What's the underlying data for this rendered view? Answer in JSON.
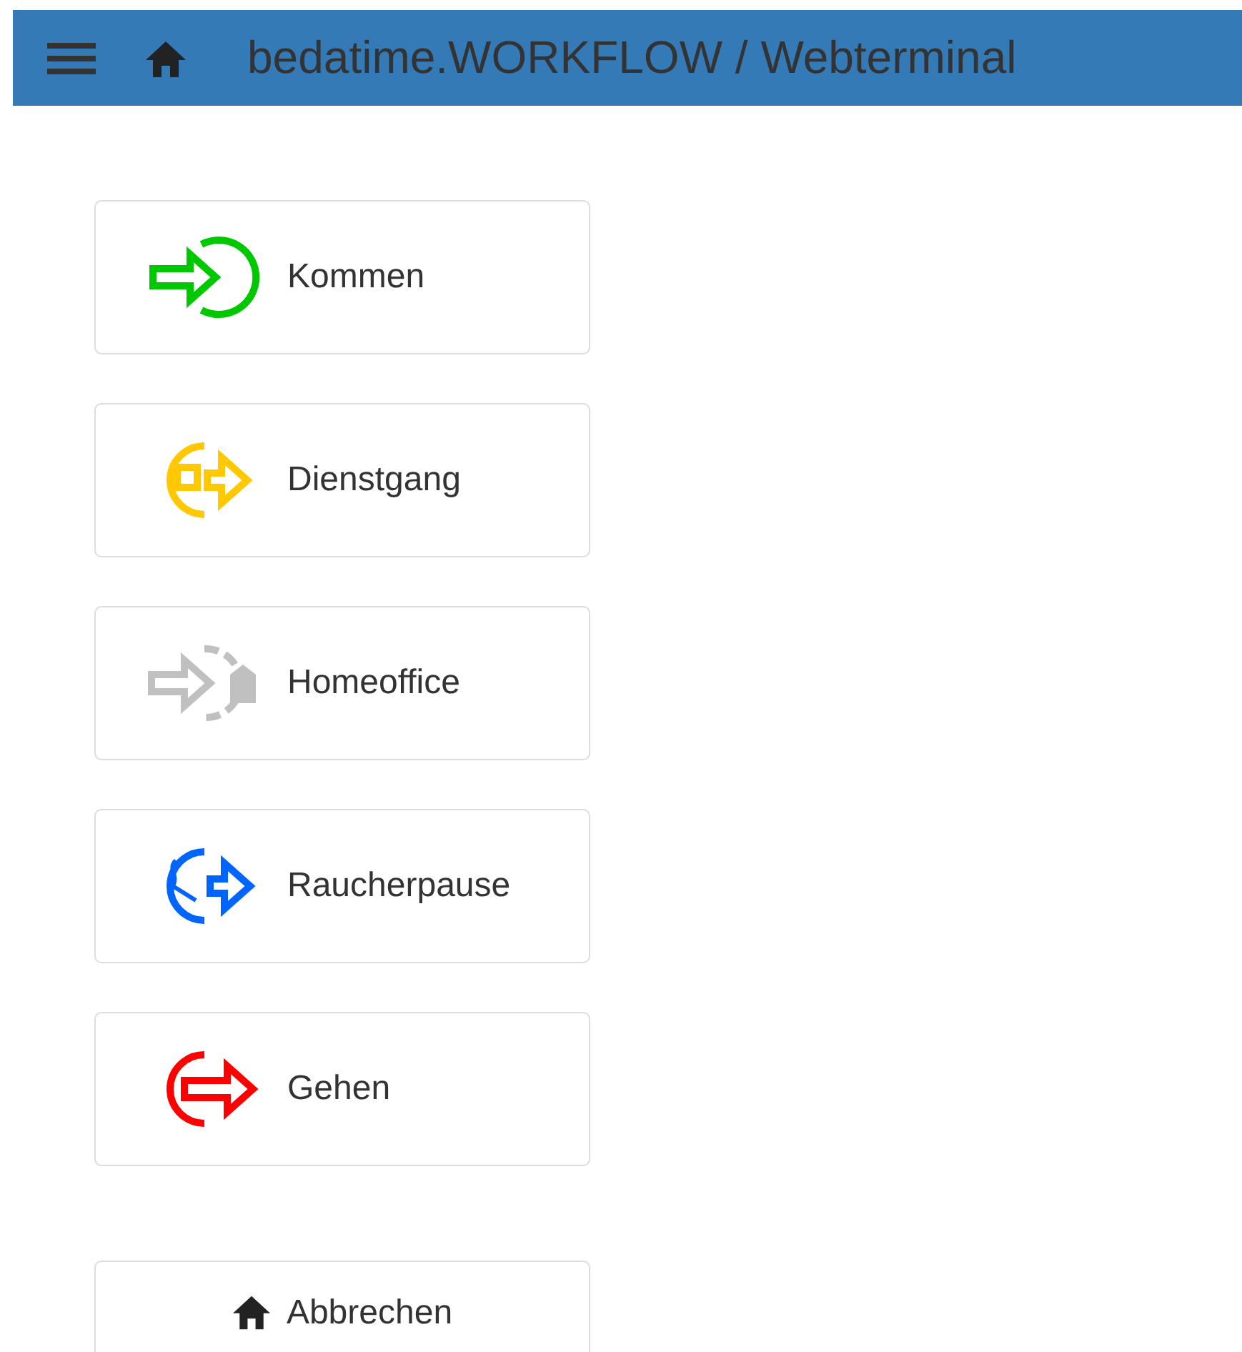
{
  "header": {
    "title": "bedatime.WORKFLOW / Webterminal"
  },
  "actions": [
    {
      "label": "Kommen",
      "kind": "in",
      "color": "#00c800"
    },
    {
      "label": "Dienstgang",
      "kind": "errand",
      "color": "#ffc800"
    },
    {
      "label": "Homeoffice",
      "kind": "home",
      "color": "#c0c0c0"
    },
    {
      "label": "Raucherpause",
      "kind": "smoke",
      "color": "#0064ff"
    },
    {
      "label": "Gehen",
      "kind": "out",
      "color": "#ff0000"
    }
  ],
  "cancel_button": {
    "label": "Abbrechen"
  }
}
